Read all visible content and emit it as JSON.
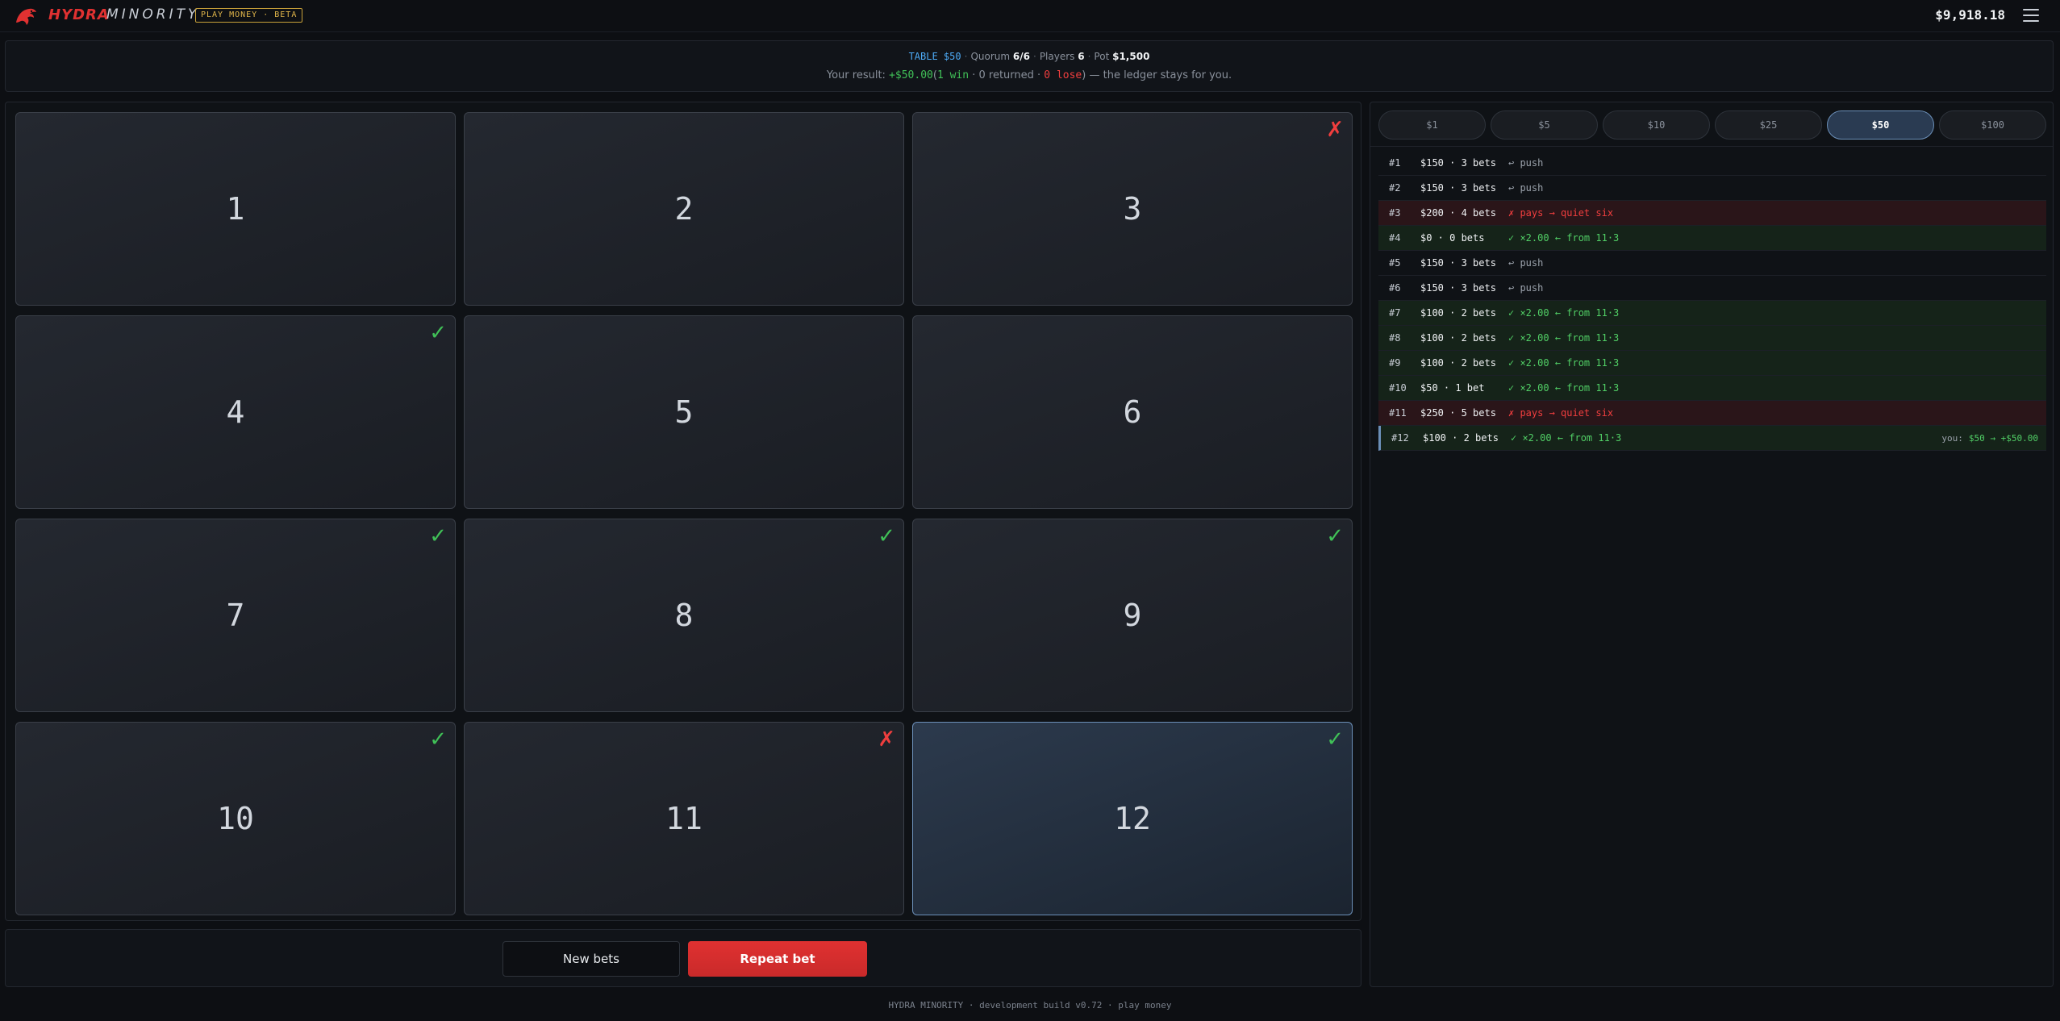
{
  "header": {
    "brand_name": "HYDRA",
    "brand_sub": "MINORITY",
    "badge": "PLAY MONEY · BETA",
    "balance": "$9,918.18"
  },
  "info": {
    "table_label": "TABLE $50",
    "quorum_label": "Quorum",
    "quorum_value": "6/6",
    "players_label": "Players",
    "players_value": "6",
    "pot_label": "Pot",
    "pot_value": "$1,500",
    "result_prefix": "Your result:",
    "result_amount": "+$50.00",
    "result_open": "(",
    "result_win": "1 win",
    "result_returned": "· 0 returned ·",
    "result_lose": "0 lose",
    "result_suffix": ") — the ledger stays for you."
  },
  "grid": {
    "cells": [
      {
        "num": "1",
        "mark": ""
      },
      {
        "num": "2",
        "mark": ""
      },
      {
        "num": "3",
        "mark": "✗"
      },
      {
        "num": "4",
        "mark": "✓"
      },
      {
        "num": "5",
        "mark": ""
      },
      {
        "num": "6",
        "mark": ""
      },
      {
        "num": "7",
        "mark": "✓"
      },
      {
        "num": "8",
        "mark": "✓"
      },
      {
        "num": "9",
        "mark": "✓"
      },
      {
        "num": "10",
        "mark": "✓"
      },
      {
        "num": "11",
        "mark": "✗"
      },
      {
        "num": "12",
        "mark": "✓"
      }
    ]
  },
  "actions": {
    "new_bets": "New bets",
    "repeat_bet": "Repeat bet"
  },
  "stakes": [
    "$1",
    "$5",
    "$10",
    "$25",
    "$50",
    "$100"
  ],
  "active_stake": "$50",
  "ledger": [
    {
      "id": "#1",
      "amount": "$150 · 3 bets",
      "result": "↩ push",
      "you": ""
    },
    {
      "id": "#2",
      "amount": "$150 · 3 bets",
      "result": "↩ push",
      "you": ""
    },
    {
      "id": "#3",
      "amount": "$200 · 4 bets",
      "result": "✗ pays → quiet six",
      "you": ""
    },
    {
      "id": "#4",
      "amount": "$0 · 0 bets",
      "result": "✓ ×2.00 ← from 11·3",
      "you": ""
    },
    {
      "id": "#5",
      "amount": "$150 · 3 bets",
      "result": "↩ push",
      "you": ""
    },
    {
      "id": "#6",
      "amount": "$150 · 3 bets",
      "result": "↩ push",
      "you": ""
    },
    {
      "id": "#7",
      "amount": "$100 · 2 bets",
      "result": "✓ ×2.00 ← from 11·3",
      "you": ""
    },
    {
      "id": "#8",
      "amount": "$100 · 2 bets",
      "result": "✓ ×2.00 ← from 11·3",
      "you": ""
    },
    {
      "id": "#9",
      "amount": "$100 · 2 bets",
      "result": "✓ ×2.00 ← from 11·3",
      "you": ""
    },
    {
      "id": "#10",
      "amount": "$50 · 1 bet",
      "result": "✓ ×2.00 ← from 11·3",
      "you": ""
    },
    {
      "id": "#11",
      "amount": "$250 · 5 bets",
      "result": "✗ pays → quiet six",
      "you": ""
    },
    {
      "id": "#12",
      "amount": "$100 · 2 bets",
      "result": "✓ ×2.00 ← from 11·3",
      "you_prefix": "you:",
      "you": "$50 → +$50.00"
    }
  ],
  "footer": "HYDRA MINORITY · development build v0.72 · play money"
}
